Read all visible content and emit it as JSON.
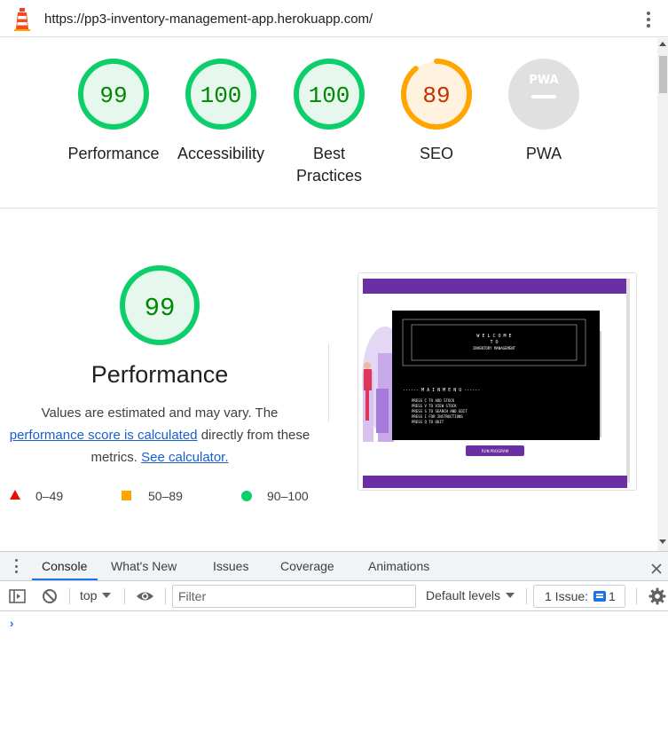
{
  "browser": {
    "url": "https://pp3-inventory-management-app.herokuapp.com/",
    "icon": "lighthouse-icon"
  },
  "gauges": [
    {
      "label": "Performance",
      "score": "99",
      "ratio": 0.99,
      "status": "pass",
      "color": "#0cce6b",
      "text_color": "#008800"
    },
    {
      "label": "Accessibility",
      "score": "100",
      "ratio": 1.0,
      "status": "pass",
      "color": "#0cce6b",
      "text_color": "#008800"
    },
    {
      "label_line1": "Best",
      "label_line2": "Practices",
      "score": "100",
      "ratio": 1.0,
      "status": "pass",
      "color": "#0cce6b",
      "text_color": "#008800"
    },
    {
      "label": "SEO",
      "score": "89",
      "ratio": 0.89,
      "status": "average",
      "color": "#ffa400",
      "text_color": "#c33300"
    },
    {
      "label": "PWA",
      "badge": "PWA",
      "status": "na",
      "color": "#e0e0e0"
    }
  ],
  "performance": {
    "score": "99",
    "title": "Performance",
    "desc_part1": "Values are estimated and may vary. The",
    "desc_link1": "performance score is calculated",
    "desc_part2": "directly from these metrics.",
    "desc_link2": "See calculator.",
    "legend": {
      "fail": "0–49",
      "average": "50–89",
      "pass": "90–100"
    }
  },
  "screenshot": {
    "banner_line1": "W E L C O M E",
    "banner_line2": "T O",
    "banner_line3": "INVENTORY MANAGEMENT",
    "menu_title": "------ M A I N   M E N U ------",
    "menu_items": [
      "PRESS C TO ADD STOCK",
      "PRESS V TO VIEW STOCK",
      "PRESS S TO SEARCH AND EDIT",
      "PRESS I FOR INSTRUCTIONS",
      "PRESS Q TO QUIT"
    ],
    "run_button": "RUN PROGRAM",
    "accent": "#6a2fa3"
  },
  "devtools": {
    "tabs": [
      "Console",
      "What's New",
      "Issues",
      "Coverage",
      "Animations"
    ],
    "active_tab": "Console",
    "context": "top",
    "filter_placeholder": "Filter",
    "levels": "Default levels",
    "issues_label": "1 Issue:",
    "issues_count": "1",
    "prompt": "›"
  }
}
